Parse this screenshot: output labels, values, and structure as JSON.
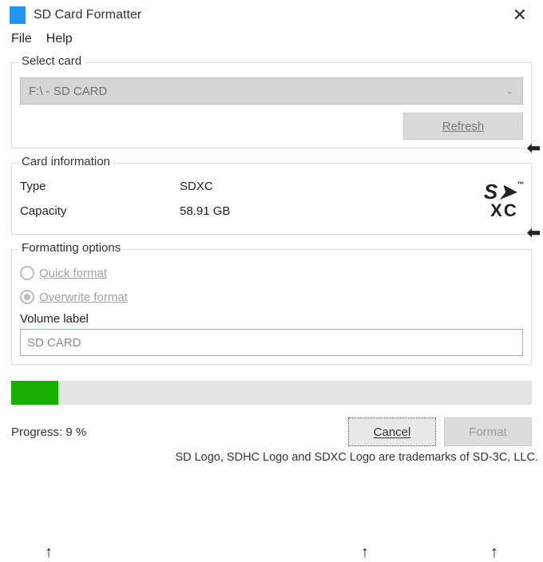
{
  "window": {
    "title": "SD Card Formatter"
  },
  "menu": {
    "file": "File",
    "help": "Help"
  },
  "select_card": {
    "group_label": "Select card",
    "value": "F:\\ - SD CARD",
    "refresh": "Refresh"
  },
  "card_info": {
    "group_label": "Card information",
    "type_label": "Type",
    "type_value": "SDXC",
    "capacity_label": "Capacity",
    "capacity_value": "58.91 GB",
    "logo": {
      "top": "S➤",
      "bottom": "XC"
    }
  },
  "formatting": {
    "group_label": "Formatting options",
    "quick": "Quick format",
    "overwrite": "Overwrite format",
    "selected": "overwrite",
    "volume_label_text": "Volume label",
    "volume_value": "SD CARD"
  },
  "progress": {
    "percent": 9,
    "text": "Progress: 9 %"
  },
  "buttons": {
    "cancel": "Cancel",
    "format": "Format"
  },
  "trademark": "SD Logo, SDHC Logo and SDXC Logo are trademarks of SD-3C, LLC."
}
